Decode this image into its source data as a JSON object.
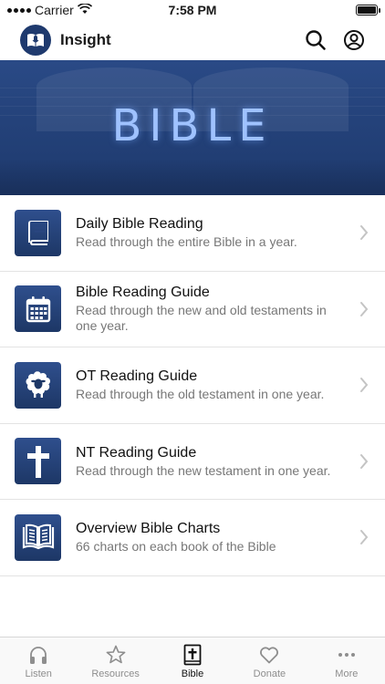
{
  "status_bar": {
    "carrier": "Carrier",
    "time": "7:58 PM",
    "battery_level": 1.0
  },
  "header": {
    "title": "Insight",
    "logo_icon": "microphone-bible-logo",
    "search_icon": "search-icon",
    "account_icon": "account-icon"
  },
  "hero": {
    "text": "BIBLE"
  },
  "list": {
    "items": [
      {
        "title": "Daily Bible Reading",
        "subtitle": "Read through the entire Bible in a year.",
        "icon": "bible-book-icon"
      },
      {
        "title": "Bible Reading Guide",
        "subtitle": "Read through the new and old testaments in one year.",
        "icon": "calendar-icon"
      },
      {
        "title": "OT Reading Guide",
        "subtitle": "Read through the old testament in one year.",
        "icon": "lamb-icon"
      },
      {
        "title": "NT Reading Guide",
        "subtitle": "Read through the new testament in one year.",
        "icon": "cross-icon"
      },
      {
        "title": "Overview Bible Charts",
        "subtitle": "66 charts on each book of the Bible",
        "icon": "open-book-icon"
      }
    ]
  },
  "tab_bar": {
    "tabs": [
      {
        "label": "Listen",
        "icon": "headphones-icon",
        "active": false
      },
      {
        "label": "Resources",
        "icon": "star-icon",
        "active": false
      },
      {
        "label": "Bible",
        "icon": "bible-cross-icon",
        "active": true
      },
      {
        "label": "Donate",
        "icon": "heart-icon",
        "active": false
      },
      {
        "label": "More",
        "icon": "more-dots-icon",
        "active": false
      }
    ]
  },
  "colors": {
    "brand_navy": "#1f3a6e",
    "hero_text": "#9fc2ff",
    "subtitle_gray": "#777777",
    "tab_inactive": "#8e8e8e"
  }
}
